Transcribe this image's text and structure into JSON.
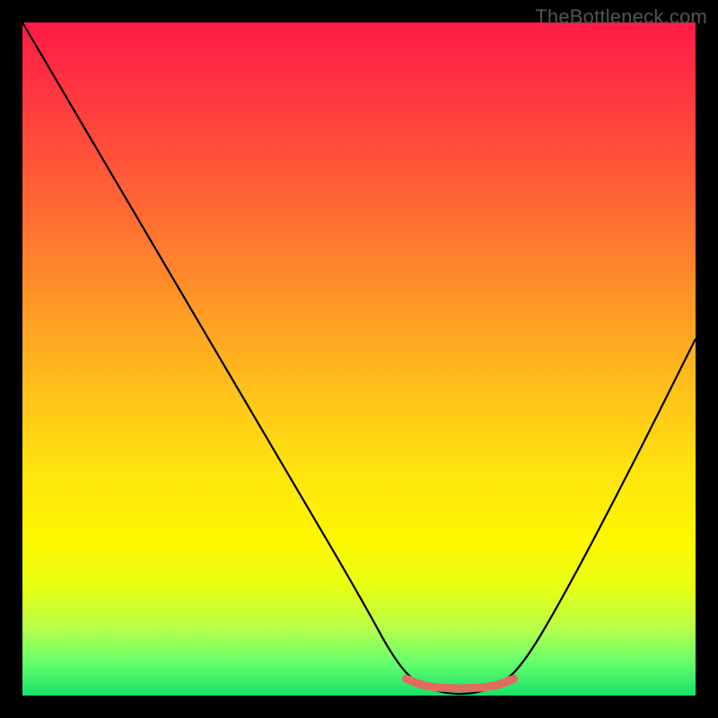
{
  "watermark": "TheBottleneck.com",
  "chart_data": {
    "type": "line",
    "title": "",
    "xlabel": "",
    "ylabel": "",
    "xlim": [
      0,
      100
    ],
    "ylim": [
      0,
      100
    ],
    "grid": false,
    "legend": false,
    "gradient_stops": [
      {
        "pos": 0,
        "color": "#ff1a46"
      },
      {
        "pos": 12,
        "color": "#ff3b3f"
      },
      {
        "pos": 28,
        "color": "#ff6a33"
      },
      {
        "pos": 42,
        "color": "#ff9826"
      },
      {
        "pos": 55,
        "color": "#ffc21a"
      },
      {
        "pos": 67,
        "color": "#ffe50d"
      },
      {
        "pos": 77,
        "color": "#fdf800"
      },
      {
        "pos": 84,
        "color": "#e7ff14"
      },
      {
        "pos": 90,
        "color": "#b6ff4a"
      },
      {
        "pos": 95,
        "color": "#66ff6a"
      },
      {
        "pos": 100,
        "color": "#19e06a"
      }
    ],
    "series": [
      {
        "name": "bottleneck-curve",
        "color": "#000000",
        "points": [
          {
            "x": 0,
            "y": 100
          },
          {
            "x": 10,
            "y": 83
          },
          {
            "x": 20,
            "y": 66
          },
          {
            "x": 30,
            "y": 49
          },
          {
            "x": 40,
            "y": 32
          },
          {
            "x": 50,
            "y": 15
          },
          {
            "x": 56,
            "y": 4
          },
          {
            "x": 60,
            "y": 1
          },
          {
            "x": 65,
            "y": 0
          },
          {
            "x": 70,
            "y": 1
          },
          {
            "x": 74,
            "y": 4
          },
          {
            "x": 80,
            "y": 14
          },
          {
            "x": 90,
            "y": 33
          },
          {
            "x": 100,
            "y": 53
          }
        ]
      },
      {
        "name": "flat-highlight",
        "color": "#e26a5e",
        "points": [
          {
            "x": 57,
            "y": 2.5
          },
          {
            "x": 60,
            "y": 1.3
          },
          {
            "x": 65,
            "y": 1.0
          },
          {
            "x": 70,
            "y": 1.3
          },
          {
            "x": 73,
            "y": 2.5
          }
        ]
      }
    ]
  }
}
